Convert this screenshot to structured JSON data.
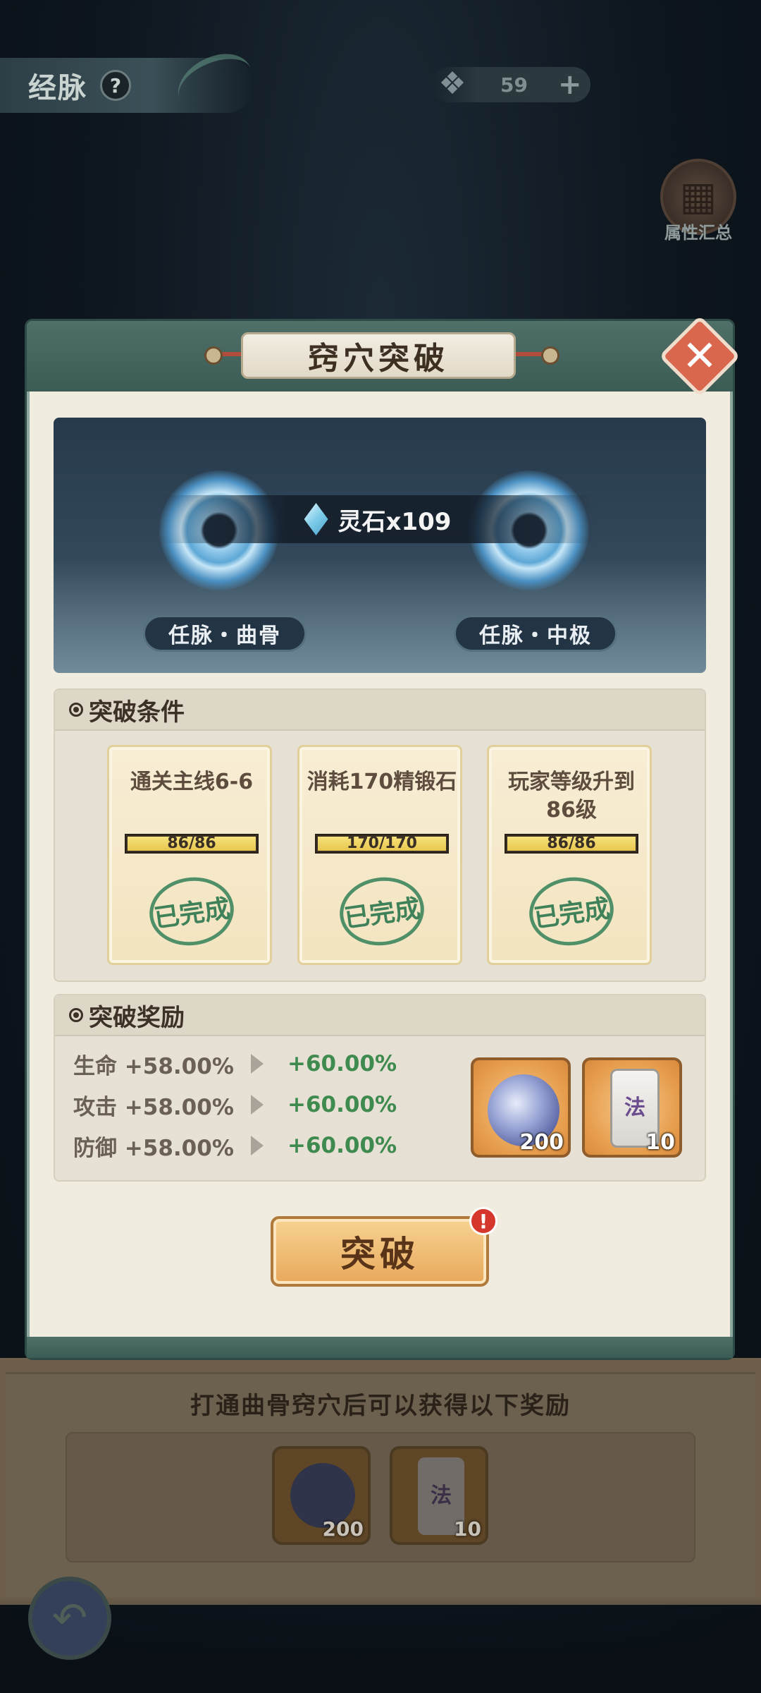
{
  "header": {
    "title": "经脉",
    "help_icon": "?",
    "energy_value": "59",
    "energy_plus": "+",
    "attr_summary_label": "属性汇总"
  },
  "background": {
    "hint": "打通曲骨窍穴后可以获得以下奖励",
    "rewards": [
      {
        "icon": "jade-fish-icon",
        "count": "200"
      },
      {
        "icon": "fa-talisman-icon",
        "glyph": "法",
        "count": "10"
      }
    ]
  },
  "modal": {
    "title": "窍穴突破",
    "close": "✕",
    "cost": "灵石x109",
    "node_from": "任脉・曲骨",
    "node_to": "任脉・中极",
    "conditions_header": "突破条件",
    "conditions": [
      {
        "text": "通关主线6-6",
        "progress": "86/86",
        "ratio": 1.0,
        "stamp": "已完成"
      },
      {
        "text": "消耗170精锻石",
        "progress": "170/170",
        "ratio": 1.0,
        "stamp": "已完成"
      },
      {
        "text": "玩家等级升到86级",
        "progress": "86/86",
        "ratio": 1.0,
        "stamp": "已完成"
      }
    ],
    "rewards_header": "突破奖励",
    "stats": [
      {
        "old": "生命 +58.00%",
        "new": "+60.00%"
      },
      {
        "old": "攻击 +58.00%",
        "new": "+60.00%"
      },
      {
        "old": "防御 +58.00%",
        "new": "+60.00%"
      }
    ],
    "reward_items": [
      {
        "icon": "jade-fish-icon",
        "count": "200"
      },
      {
        "icon": "fa-talisman-icon",
        "glyph": "法",
        "count": "10"
      }
    ],
    "break_button": "突破",
    "alert": "!"
  }
}
